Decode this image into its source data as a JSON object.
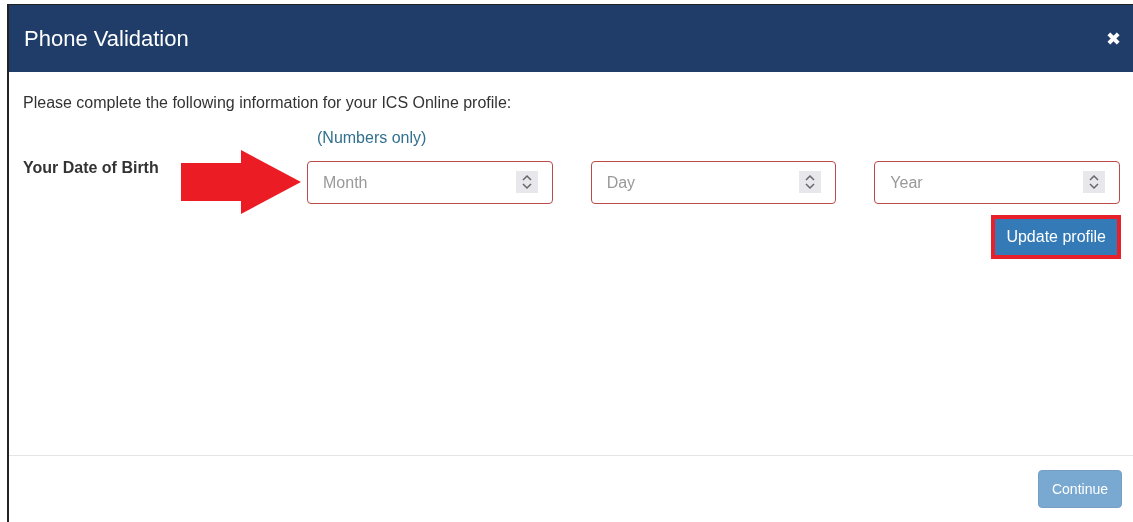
{
  "dialog": {
    "title": "Phone Validation",
    "close": "✖",
    "intro": "Please complete the following information for your ICS Online profile:",
    "hint": "(Numbers only)",
    "field_label": "Your Date of Birth",
    "fields": [
      {
        "placeholder": "Month"
      },
      {
        "placeholder": "Day"
      },
      {
        "placeholder": "Year"
      }
    ],
    "update_button": {
      "label": "Update profile"
    },
    "continue_button": {
      "label": "Continue",
      "disabled": true
    }
  }
}
